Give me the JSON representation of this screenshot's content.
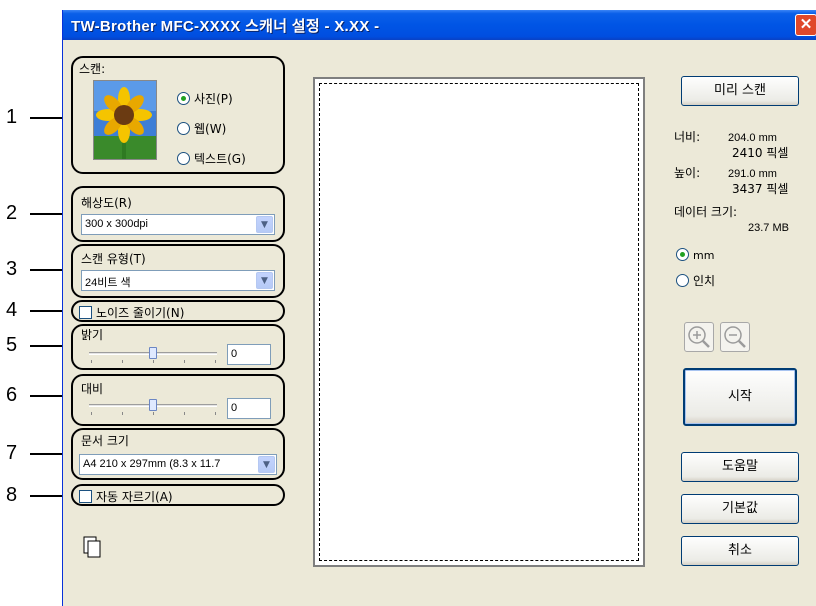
{
  "window": {
    "title": "TW-Brother MFC-XXXX 스캐너 설정 - X.XX -",
    "close_icon": "close-icon"
  },
  "callouts": [
    "1",
    "2",
    "3",
    "4",
    "5",
    "6",
    "7",
    "8"
  ],
  "scan": {
    "label": "스캔:",
    "options": [
      {
        "label": "사진(P)",
        "selected": true
      },
      {
        "label": "웹(W)",
        "selected": false
      },
      {
        "label": "텍스트(G)",
        "selected": false
      }
    ]
  },
  "resolution": {
    "label": "해상도(R)",
    "value": "300 x 300dpi"
  },
  "scan_type": {
    "label": "스캔 유형(T)",
    "value": "24비트 색"
  },
  "noise": {
    "label": "노이즈 줄이기(N)",
    "checked": false
  },
  "brightness": {
    "label": "밝기",
    "value": "0",
    "level": 0.5
  },
  "contrast": {
    "label": "대비",
    "value": "0",
    "level": 0.5
  },
  "doc_size": {
    "label": "문서 크기",
    "value": "A4 210 x 297mm (8.3 x 11.7"
  },
  "auto_crop": {
    "label": "자동 자르기(A)",
    "checked": false
  },
  "buttons": {
    "prescan": "미리 스캔",
    "start": "시작",
    "help": "도움말",
    "default": "기본값",
    "cancel": "취소"
  },
  "info": {
    "width_label": "너비:",
    "width_mm": "204.0 mm",
    "width_px": "2410 픽셀",
    "height_label": "높이:",
    "height_mm": "291.0 mm",
    "height_px": "3437 픽셀",
    "datasize_label": "데이터 크기:",
    "datasize_value": "23.7 MB"
  },
  "units": [
    {
      "label": "mm",
      "selected": true
    },
    {
      "label": "인치",
      "selected": false
    }
  ],
  "colors": {
    "titlebar": "#0055e5",
    "window": "#ece9d8",
    "radio_dot": "#21a121"
  }
}
